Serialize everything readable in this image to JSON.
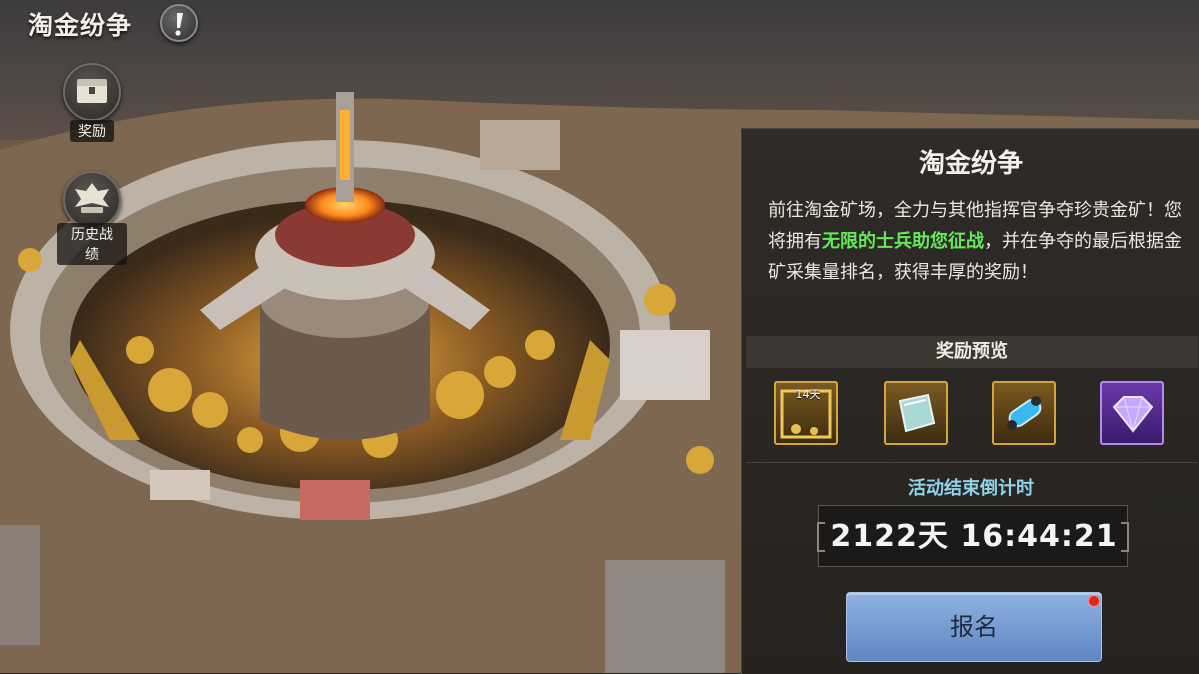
{
  "header": {
    "title": "淘金纷争"
  },
  "side_buttons": [
    {
      "label": "奖励",
      "icon": "reward-chest-icon"
    },
    {
      "label": "历史战绩",
      "icon": "history-record-icon"
    }
  ],
  "panel": {
    "title": "淘金纷争",
    "desc_before": "前往淘金矿场，全力与其他指挥官争夺珍贵金矿！您将拥有",
    "desc_highlight": "无限的士兵助您征战",
    "desc_after": "，并在争夺的最后根据金矿采集量排名，获得丰厚的奖励！",
    "rewards_header": "奖励预览",
    "rewards": [
      {
        "icon": "gold-frame-14day-icon",
        "badge": "14天"
      },
      {
        "icon": "metal-plate-icon"
      },
      {
        "icon": "blue-capsule-icon"
      },
      {
        "icon": "purple-diamond-icon"
      }
    ],
    "countdown_label": "活动结束倒计时",
    "countdown": "2122天  16:44:21",
    "signup_label": "报名"
  },
  "colors": {
    "highlight": "#66e85a",
    "countdown_label": "#8fd4ea",
    "button": "#7a9fd6",
    "notify": "#e0241e"
  }
}
